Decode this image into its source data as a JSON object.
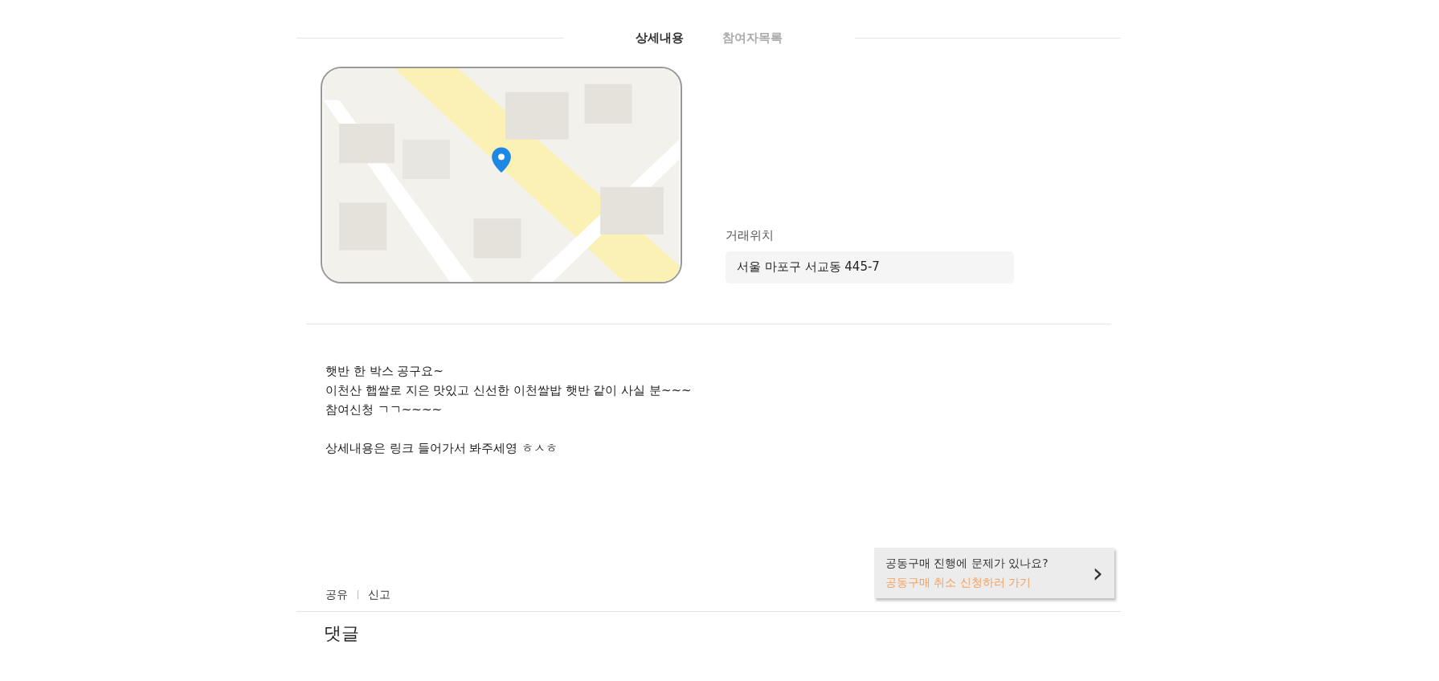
{
  "tabs": [
    {
      "label": "상세내용",
      "selected": true
    },
    {
      "label": "참여자목록",
      "selected": false
    }
  ],
  "map": {
    "kind": "picture"
  },
  "location": {
    "label": "거래위치",
    "value": "서울 마포구 서교동 445-7"
  },
  "description": {
    "paragraphs": [
      [
        "햇반 한 박스 공구요~",
        "이천산 햅쌀로 지은 맛있고 신선한 이천쌀밥 햇반 같이 사실 분~~~",
        "참여신청 ㄱㄱ~~~~"
      ],
      [
        "상세내용은 링크 들어가서 봐주세영 ㅎㅅㅎ"
      ]
    ]
  },
  "actions": [
    "공유",
    "신고"
  ],
  "help_card": {
    "question": "공동구매 진행에 문제가 있나요?",
    "link": "공동구매 취소 신청하러 가기",
    "arrow": "›"
  },
  "comments": {
    "title": "댓글"
  }
}
